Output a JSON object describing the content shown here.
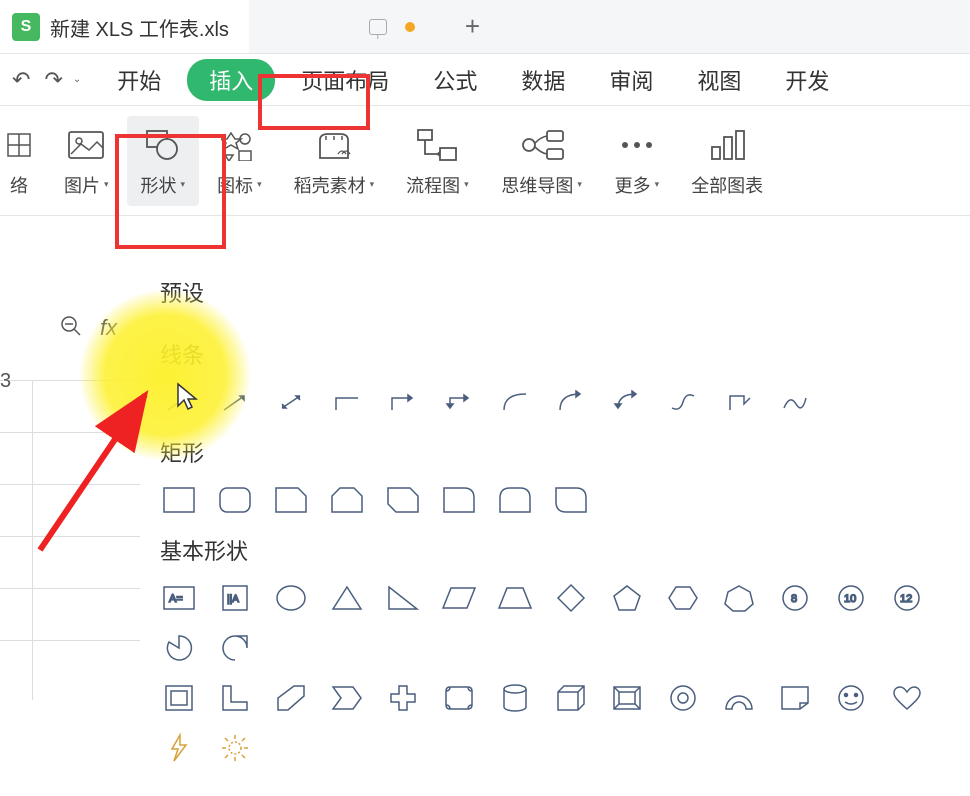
{
  "tab": {
    "app_letter": "S",
    "title": "新建 XLS 工作表.xls"
  },
  "menu": {
    "start": "开始",
    "insert": "插入",
    "page_layout": "页面布局",
    "formula": "公式",
    "data": "数据",
    "review": "审阅",
    "view": "视图",
    "dev": "开发"
  },
  "ribbon": {
    "grid_partial": "络",
    "image": "图片",
    "shapes": "形状",
    "icons": "图标",
    "material": "稻壳素材",
    "flowchart": "流程图",
    "mindmap": "思维导图",
    "more": "更多",
    "all_charts": "全部图表"
  },
  "shapes_panel": {
    "preset": "预设",
    "lines": "线条",
    "rectangles": "矩形",
    "basic_shapes": "基本形状",
    "badge_8": "8",
    "badge_10": "10",
    "badge_12": "12"
  },
  "partial": {
    "b": "3"
  }
}
